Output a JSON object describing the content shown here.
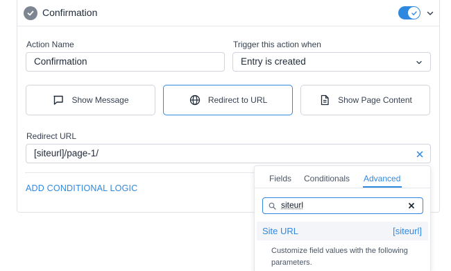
{
  "header": {
    "title": "Confirmation",
    "enabled": true
  },
  "form": {
    "action_name": {
      "label": "Action Name",
      "value": "Confirmation"
    },
    "trigger": {
      "label": "Trigger this action when",
      "selected": "Entry is created"
    },
    "types": [
      {
        "label": "Show Message",
        "icon": "message-icon",
        "active": false
      },
      {
        "label": "Redirect to URL",
        "icon": "globe-icon",
        "active": true
      },
      {
        "label": "Show Page Content",
        "icon": "document-icon",
        "active": false
      }
    ],
    "redirect": {
      "label": "Redirect URL",
      "value": "[siteurl]/page-1/"
    },
    "conditional_link": "ADD CONDITIONAL LOGIC"
  },
  "dropdown": {
    "tabs": [
      {
        "label": "Fields",
        "active": false
      },
      {
        "label": "Conditionals",
        "active": false
      },
      {
        "label": "Advanced",
        "active": true
      }
    ],
    "search_value": "siteurl",
    "result": {
      "name": "Site URL",
      "tag": "[siteurl]"
    },
    "help": "Customize field values with the following parameters."
  },
  "colors": {
    "accent": "#2f88e0",
    "badge": "#7d8590",
    "border": "#d1d5db"
  }
}
